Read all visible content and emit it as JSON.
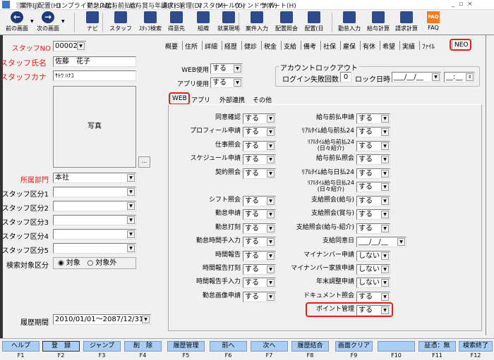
{
  "menu": [
    {
      "label": "営業(G)",
      "disabled": true
    },
    {
      "label": "案件(J)"
    },
    {
      "label": "配置(H)"
    },
    {
      "label": "コンプライアンス(C)"
    },
    {
      "label": "勤怠(N)"
    },
    {
      "label": "給与前払(I)"
    },
    {
      "label": "給与賞与年調(T)"
    },
    {
      "label": "請求(S)"
    },
    {
      "label": "管理(D)"
    },
    {
      "label": "マスタ(M)"
    },
    {
      "label": "ツール(O)"
    },
    {
      "label": "ウィンドウ(W)"
    },
    {
      "label": "サポート(H)"
    }
  ],
  "toolbar": [
    {
      "label": "前の画面",
      "icon": "arrow-left-icon"
    },
    {
      "label": "次の画面",
      "icon": "arrow-right-icon"
    },
    {
      "label": "ナビ",
      "icon": "navi-icon"
    },
    {
      "label": "スタッフ",
      "icon": "staff-icon"
    },
    {
      "label": "ｽﾀｯﾌ検索",
      "icon": "staff-search-icon"
    },
    {
      "label": "得意先",
      "icon": "customer-icon"
    },
    {
      "label": "組織",
      "icon": "organization-icon"
    },
    {
      "label": "就業現場",
      "icon": "worksite-icon"
    },
    {
      "label": "案件入力",
      "icon": "project-input-icon"
    },
    {
      "label": "配置照会",
      "icon": "placement-inquiry-icon"
    },
    {
      "label": "配置(日",
      "icon": "placement-daily-icon"
    },
    {
      "label": "勤怠入力",
      "icon": "attendance-input-icon"
    },
    {
      "label": "給与計算",
      "icon": "payroll-icon"
    },
    {
      "label": "請求計算",
      "icon": "billing-icon"
    },
    {
      "label": "FAQ",
      "icon": "faq-icon"
    }
  ],
  "left": {
    "staff_no_label": "スタッフNO",
    "staff_no": "000021",
    "name_label": "スタッフ氏名",
    "name": "佐藤　花子",
    "kana_label": "スタッフカナ",
    "kana": "ｻﾄｳ ﾊﾅｺ",
    "photo_label": "写真",
    "photo_button": "...",
    "dept_label": "所属部門",
    "dept": "本社",
    "categories": [
      "スタッフ区分1",
      "スタッフ区分2",
      "スタッフ区分3",
      "スタッフ区分4",
      "スタッフ区分5"
    ],
    "search_label": "検索対象区分",
    "search_opt1": "対象",
    "search_opt2": "対象外",
    "history_label": "履歴期間",
    "history": "2010/01/01～2087/12/31 ."
  },
  "tabs": [
    "概要",
    "住所",
    "詳細",
    "経歴",
    "健診",
    "税金",
    "支給",
    "備考",
    "社保",
    "雇保",
    "有休",
    "希望",
    "実績",
    "ﾌｧｲﾙ",
    "NEO"
  ],
  "neo": {
    "web_use_label": "WEB使用",
    "web_use": "する",
    "app_use_label": "アプリ使用",
    "app_use": "する",
    "lockout_title": "アカウントロックアウト",
    "fail_label": "ログイン失敗回数",
    "fail_count": "0",
    "lock_label": "ロック日時",
    "lock_date": "___/__/__",
    "lock_time": "__:__"
  },
  "subtabs": [
    "WEB",
    "アプリ",
    "外部連携",
    "その他"
  ],
  "left_rows": [
    [
      "同意確認",
      "する"
    ],
    [
      "プロフィール申請",
      "する"
    ],
    [
      "仕事照会",
      "する"
    ],
    [
      "スケジュール申請",
      "する"
    ],
    [
      "契約照会",
      "する"
    ],
    null,
    [
      "シフト照会",
      "する"
    ],
    [
      "勤怠申請",
      "する"
    ],
    [
      "勤怠打刻",
      "する"
    ],
    [
      "勤怠時間手入力",
      "する"
    ],
    [
      "時間報告",
      "する"
    ],
    [
      "時間報告打刻",
      "する"
    ],
    [
      "時間報告手入力",
      "する"
    ],
    [
      "勤怠画像申請",
      "する"
    ],
    null
  ],
  "right_rows": [
    [
      "給与前払申請",
      "する"
    ],
    [
      "ﾘｱﾙﾀｲﾑ給与前払24",
      "する"
    ],
    [
      "ﾘｱﾙﾀｲﾑ給与前払24\n(日々紹介)",
      "する"
    ],
    [
      "給与前払照会",
      "する"
    ],
    [
      "ﾘｱﾙﾀｲﾑ給与日払24",
      "する"
    ],
    [
      "ﾘｱﾙﾀｲﾑ給与日払24\n(日々紹介)",
      "する"
    ],
    [
      "支給照会(給与)",
      "する"
    ],
    [
      "支給照会(賞与)",
      "する"
    ],
    [
      "支給照会(給与-紹介)",
      "する"
    ],
    [
      "支給同意日",
      "___/__/__"
    ],
    [
      "マイナンバー申請",
      "しない"
    ],
    [
      "マイナンバー家族申請",
      "しない"
    ],
    [
      "年末調整申請",
      "しない"
    ],
    [
      "ドキュメント照会",
      "する"
    ],
    [
      "ポイント管理",
      "する"
    ]
  ],
  "fkeys": [
    [
      "ヘルプ",
      "F1"
    ],
    [
      "登　録",
      "F2"
    ],
    [
      "ジャンプ",
      "F3"
    ],
    [
      "削　除",
      "F4"
    ],
    [
      "履歴管理",
      "F5"
    ],
    [
      "前へ",
      "F6"
    ],
    [
      "次へ",
      "F7"
    ],
    [
      "履歴結合",
      "F8"
    ],
    [
      "画面クリア",
      "F9"
    ],
    [
      "",
      "F10"
    ],
    [
      "証憑：無",
      "F11"
    ],
    [
      "検索終了",
      "F12"
    ]
  ],
  "colors": {
    "required": "#e0201c",
    "highlight": "#e0201c",
    "fkey_bg": "#a9cdf5"
  }
}
